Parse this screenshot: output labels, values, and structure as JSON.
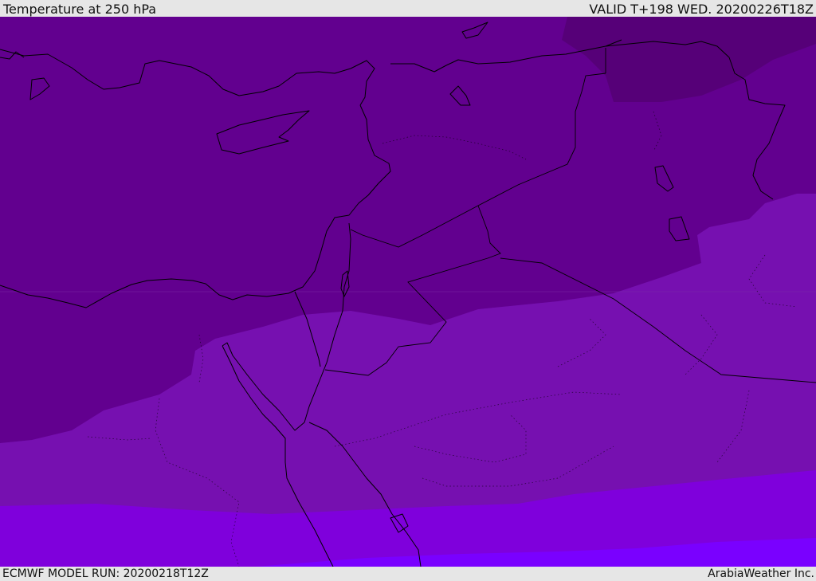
{
  "header": {
    "title": "Temperature at 250 hPa",
    "valid_time": "VALID T+198 WED. 20200226T18Z"
  },
  "footer": {
    "model_run": "ECMWF MODEL RUN: 20200218T12Z",
    "credit": "ArabiaWeather Inc."
  },
  "colors": {
    "band_coldest": "#560078",
    "band_cold": "#62008f",
    "band_mid": "#7610b0",
    "band_warm": "#7f00dc",
    "band_warmest": "#7a00ff",
    "coastline": "#000000"
  }
}
